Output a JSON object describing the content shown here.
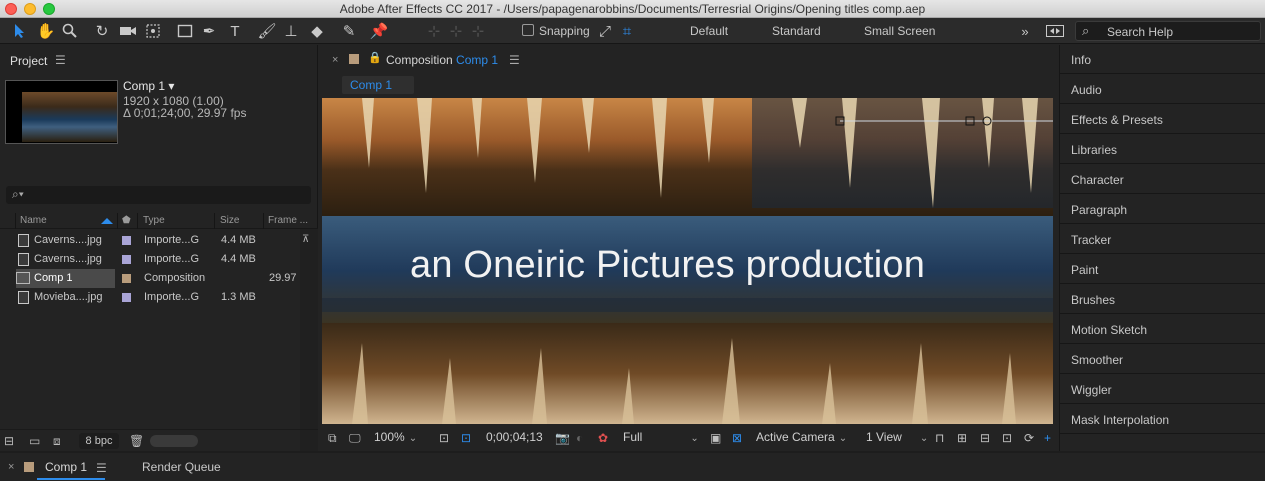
{
  "window": {
    "title": "Adobe After Effects CC 2017 - /Users/papagenarobbins/Documents/Terresrial Origins/Opening titles comp.aep"
  },
  "toolbar": {
    "snapping_label": "Snapping",
    "workspaces": [
      "Default",
      "Standard",
      "Small Screen"
    ],
    "search_placeholder": "Search Help"
  },
  "project": {
    "panel_title": "Project",
    "selected_item": {
      "name": "Comp 1 ▾",
      "resolution": "1920 x 1080 (1.00)",
      "duration": "Δ 0;01;24;00, 29.97 fps"
    },
    "search_icon": "⌕▾",
    "columns": {
      "name": "Name",
      "type": "Type",
      "size": "Size",
      "frame": "Frame ..."
    },
    "items": [
      {
        "name": "Caverns....jpg",
        "type": "Importe...G",
        "size": "4.4 MB",
        "fps": "",
        "label_color": "#a9a4d6",
        "icon": "file"
      },
      {
        "name": "Caverns....jpg",
        "type": "Importe...G",
        "size": "4.4 MB",
        "fps": "",
        "label_color": "#a9a4d6",
        "icon": "file"
      },
      {
        "name": "Comp 1",
        "type": "Composition",
        "size": "",
        "fps": "29.97",
        "label_color": "#b89c7c",
        "icon": "composition"
      },
      {
        "name": "Movieba....jpg",
        "type": "Importe...G",
        "size": "1.3 MB",
        "fps": "",
        "label_color": "#a9a4d6",
        "icon": "file"
      }
    ],
    "bpc": "8 bpc"
  },
  "composition": {
    "panel_prefix": "Composition",
    "comp_name": "Comp 1",
    "tab_label": "Comp 1",
    "overlay_text": "an Oneiric Pictures production",
    "zoom": "100%",
    "timecode": "0;00;04;13",
    "resolution": "Full",
    "camera": "Active Camera",
    "views": "1 View"
  },
  "right_panel": {
    "items": [
      "Info",
      "Audio",
      "Effects & Presets",
      "Libraries",
      "Character",
      "Paragraph",
      "Tracker",
      "Paint",
      "Brushes",
      "Motion Sketch",
      "Smoother",
      "Wiggler",
      "Mask Interpolation"
    ]
  },
  "timeline": {
    "comp_tab": "Comp 1",
    "render_queue": "Render Queue"
  },
  "colors": {
    "accent": "#2d8ceb",
    "panel_bg": "#232323",
    "comp_label": "#b89c7c",
    "footage_label": "#a9a4d6"
  }
}
